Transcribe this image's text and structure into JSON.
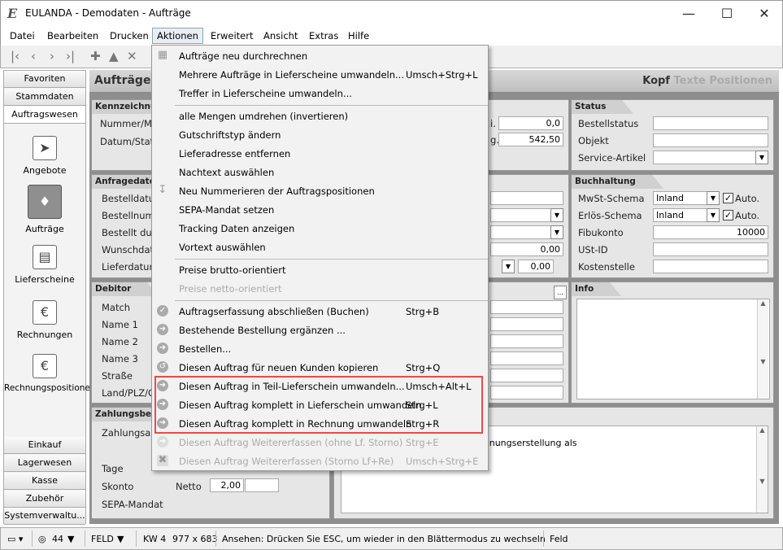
{
  "window": {
    "title": "EULANDA - Demodaten - Aufträge",
    "logo": "E"
  },
  "menubar": [
    "Datei",
    "Bearbeiten",
    "Drucken",
    "Aktionen",
    "Erweitert",
    "Ansicht",
    "Extras",
    "Hilfe"
  ],
  "nav": {
    "categories_top": [
      "Favoriten",
      "Stammdaten",
      "Auftragswesen"
    ],
    "items": [
      {
        "label": "Angebote",
        "icon": "quote-icon"
      },
      {
        "label": "Aufträge",
        "icon": "handshake-icon"
      },
      {
        "label": "Lieferscheine",
        "icon": "truck-icon"
      },
      {
        "label": "Rechnungen",
        "icon": "euro-document-icon"
      },
      {
        "label": "Rechnungspositionen",
        "icon": "euro-document-icon"
      }
    ],
    "categories_bottom": [
      "Einkauf",
      "Lagerwesen",
      "Kasse",
      "Zubehör",
      "Systemverwaltu..."
    ]
  },
  "header": {
    "title": "Aufträge",
    "tab_active": "Kopf",
    "tab2": "Texte",
    "tab3": "Positionen"
  },
  "panels": {
    "kenn": {
      "title": "Kennzeichnung",
      "l1": "Nummer/M",
      "l2": "Datum/Stat",
      "v1": "0,0",
      "v2": "542,50",
      "s1": "i.",
      "s2": "g."
    },
    "status": {
      "title": "Status",
      "l1": "Bestellstatus",
      "l2": "Objekt",
      "l3": "Service-Artikel"
    },
    "anfrage": {
      "title": "Anfragedaten",
      "labels": [
        "Bestelldatu",
        "Bestellnum",
        "Bestellt dur",
        "Wunschdat",
        "Lieferdatun"
      ],
      "v1": "0,00",
      "v2": "0,00"
    },
    "buch": {
      "title": "Buchhaltung",
      "l1": "MwSt-Schema",
      "l2": "Erlös-Schema",
      "l3": "Fibukonto",
      "l4": "USt-ID",
      "l5": "Kostenstelle",
      "v1": "Inland",
      "v2": "Inland",
      "auto": "Auto.",
      "fibu": "10000"
    },
    "debitor": {
      "title": "Debitor",
      "labels": [
        "Match",
        "Name 1",
        "Name 2",
        "Name 3",
        "Straße",
        "Land/PLZ/O"
      ]
    },
    "info": {
      "title": "Info"
    },
    "zahlung": {
      "title": "Zahlungsbedin",
      "l1": "Zahlungsar",
      "l2": "Tage",
      "l3": "Skonto",
      "l4": "SEPA-Mandat",
      "netto": "Netto",
      "skonto_val": "2,00",
      "text1": "stellung..",
      "text2": "n ist, gilt der Zeitpunkt der Rechnungserstellung als"
    }
  },
  "context_menu": [
    {
      "label": "Aufträge neu durchrechnen",
      "shortcut": "",
      "icon": "calculator-icon",
      "disabled": false,
      "sep_after": false
    },
    {
      "label": "Mehrere Aufträge in Lieferscheine umwandeln...",
      "shortcut": "Umsch+Strg+L",
      "icon": "",
      "disabled": false,
      "sep_after": false
    },
    {
      "label": "Treffer in Lieferscheine umwandeln...",
      "shortcut": "",
      "icon": "",
      "disabled": false,
      "sep_after": true
    },
    {
      "label": "alle Mengen umdrehen (invertieren)",
      "shortcut": "",
      "icon": "",
      "disabled": false,
      "sep_after": false
    },
    {
      "label": "Gutschriftstyp ändern",
      "shortcut": "",
      "icon": "",
      "disabled": false,
      "sep_after": false
    },
    {
      "label": "Lieferadresse entfernen",
      "shortcut": "",
      "icon": "",
      "disabled": false,
      "sep_after": false
    },
    {
      "label": "Nachtext auswählen",
      "shortcut": "",
      "icon": "",
      "disabled": false,
      "sep_after": false
    },
    {
      "label": "Neu Nummerieren der Auftragspositionen",
      "shortcut": "",
      "icon": "sort-icon",
      "disabled": false,
      "sep_after": false
    },
    {
      "label": "SEPA-Mandat setzen",
      "shortcut": "",
      "icon": "",
      "disabled": false,
      "sep_after": false
    },
    {
      "label": "Tracking Daten anzeigen",
      "shortcut": "",
      "icon": "",
      "disabled": false,
      "sep_after": false
    },
    {
      "label": "Vortext auswählen",
      "shortcut": "",
      "icon": "",
      "disabled": false,
      "sep_after": true
    },
    {
      "label": "Preise brutto-orientiert",
      "shortcut": "",
      "icon": "",
      "disabled": false,
      "sep_after": false
    },
    {
      "label": "Preise netto-orientiert",
      "shortcut": "",
      "icon": "",
      "disabled": true,
      "sep_after": true
    },
    {
      "label": "Auftragserfassung abschließen (Buchen)",
      "shortcut": "Strg+B",
      "icon": "check-circle-icon",
      "disabled": false,
      "sep_after": false
    },
    {
      "label": "Bestehende Bestellung ergänzen ...",
      "shortcut": "",
      "icon": "arrow-circle-icon",
      "disabled": false,
      "sep_after": false
    },
    {
      "label": "Bestellen...",
      "shortcut": "",
      "icon": "arrow-circle-icon",
      "disabled": false,
      "sep_after": false
    },
    {
      "label": "Diesen Auftrag für neuen Kunden kopieren",
      "shortcut": "Strg+Q",
      "icon": "copy-circle-icon",
      "disabled": false,
      "sep_after": false
    },
    {
      "label": "Diesen Auftrag in Teil-Lieferschein umwandeln...",
      "shortcut": "Umsch+Alt+L",
      "icon": "arrow-circle-icon",
      "disabled": false,
      "sep_after": false
    },
    {
      "label": "Diesen Auftrag komplett in Lieferschein umwandeln",
      "shortcut": "Strg+L",
      "icon": "arrow-circle-icon",
      "disabled": false,
      "sep_after": false
    },
    {
      "label": "Diesen Auftrag komplett in Rechnung umwandeln",
      "shortcut": "Strg+R",
      "icon": "arrow-circle-icon",
      "disabled": false,
      "sep_after": false
    },
    {
      "label": "Diesen Auftrag Weitererfassen (ohne Lf. Storno)",
      "shortcut": "Strg+E",
      "icon": "arrow-circle-icon",
      "disabled": true,
      "sep_after": false
    },
    {
      "label": "Diesen Auftrag Weitererfassen (Storno Lf+Re)",
      "shortcut": "Umsch+Strg+E",
      "icon": "close-icon",
      "disabled": true,
      "sep_after": false
    }
  ],
  "statusbar": {
    "zoom": "44",
    "mode": "FELD",
    "kw": "KW 4",
    "size": "977 x 683",
    "hint": "Ansehen: Drücken Sie ESC, um wieder in den Blättermodus zu wechseln",
    "field": "Feld"
  }
}
